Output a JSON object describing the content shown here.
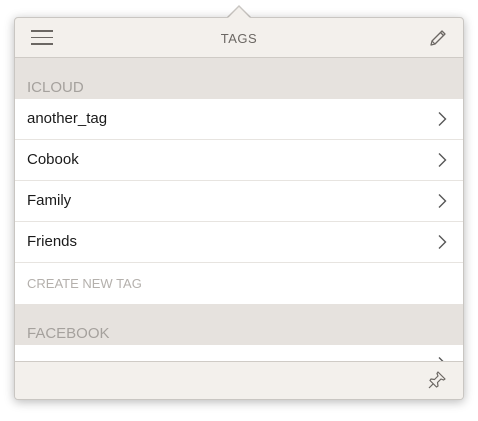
{
  "header": {
    "title": "TAGS",
    "menu_icon": "hamburger-menu-icon",
    "edit_icon": "pencil-icon"
  },
  "sections": [
    {
      "title": "ICLOUD",
      "items": [
        {
          "label": "another_tag"
        },
        {
          "label": "Cobook"
        },
        {
          "label": "Family"
        },
        {
          "label": "Friends"
        }
      ],
      "create_label": "CREATE NEW TAG"
    },
    {
      "title": "FACEBOOK"
    }
  ],
  "footer": {
    "pin_icon": "pin-icon"
  },
  "colors": {
    "background": "#f3f0ec",
    "section_header": "#e6e2de",
    "section_text": "#a5a19d",
    "row_text": "#1a1a1a",
    "muted_text": "#b4b0ac"
  }
}
